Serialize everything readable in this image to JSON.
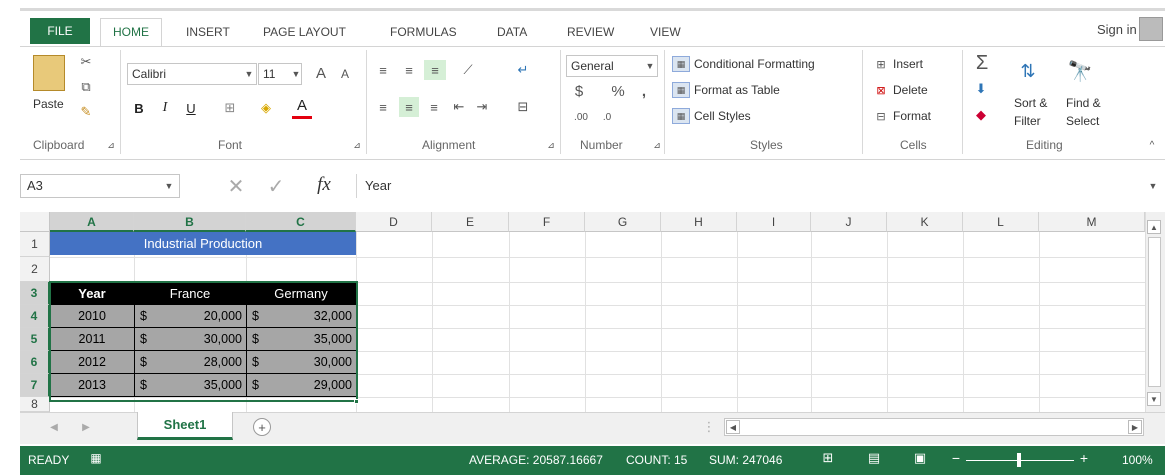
{
  "tabs": {
    "file": "FILE",
    "home": "HOME",
    "insert": "INSERT",
    "page_layout": "PAGE LAYOUT",
    "formulas": "FORMULAS",
    "data": "DATA",
    "review": "REVIEW",
    "view": "VIEW",
    "sign_in": "Sign in"
  },
  "ribbon": {
    "clipboard": {
      "paste": "Paste",
      "label": "Clipboard"
    },
    "font": {
      "name": "Calibri",
      "size": "11",
      "bold": "B",
      "italic": "I",
      "underline": "U",
      "grow": "A",
      "shrink": "A",
      "color_letter": "A",
      "label": "Font"
    },
    "alignment": {
      "label": "Alignment"
    },
    "number": {
      "format": "General",
      "currency": "$",
      "percent": "%",
      "comma": ",",
      "inc_dec": ".00",
      "dec_dec": ".0",
      "label": "Number"
    },
    "styles": {
      "conditional": "Conditional Formatting",
      "table": "Format as Table",
      "cell": "Cell Styles",
      "label": "Styles"
    },
    "cells": {
      "insert": "Insert",
      "delete": "Delete",
      "format": "Format",
      "label": "Cells"
    },
    "editing": {
      "sort1": "Sort &",
      "sort2": "Filter",
      "find1": "Find &",
      "find2": "Select",
      "label": "Editing"
    }
  },
  "formula_bar": {
    "name_box": "A3",
    "fx": "fx",
    "content": "Year"
  },
  "columns": [
    "A",
    "B",
    "C",
    "D",
    "E",
    "F",
    "G",
    "H",
    "I",
    "J",
    "K",
    "L",
    "M"
  ],
  "rows": [
    "1",
    "2",
    "3",
    "4",
    "5",
    "6",
    "7",
    "8"
  ],
  "sheet": {
    "title": "Industrial Production",
    "headers": [
      "Year",
      "France",
      "Germany"
    ],
    "data": [
      {
        "year": "2010",
        "cur1": "$",
        "france": "20,000",
        "cur2": "$",
        "germany": "32,000"
      },
      {
        "year": "2011",
        "cur1": "$",
        "france": "30,000",
        "cur2": "$",
        "germany": "35,000"
      },
      {
        "year": "2012",
        "cur1": "$",
        "france": "28,000",
        "cur2": "$",
        "germany": "30,000"
      },
      {
        "year": "2013",
        "cur1": "$",
        "france": "35,000",
        "cur2": "$",
        "germany": "29,000"
      }
    ]
  },
  "sheet_tab": "Sheet1",
  "status": {
    "ready": "READY",
    "average": "AVERAGE: 20587.16667",
    "count": "COUNT: 15",
    "sum": "SUM: 247046",
    "zoom": "100%"
  },
  "colors": {
    "accent": "#217346",
    "title_fill": "#4472c4",
    "header_fill": "#000000",
    "data_fill": "#a6a6a6"
  }
}
